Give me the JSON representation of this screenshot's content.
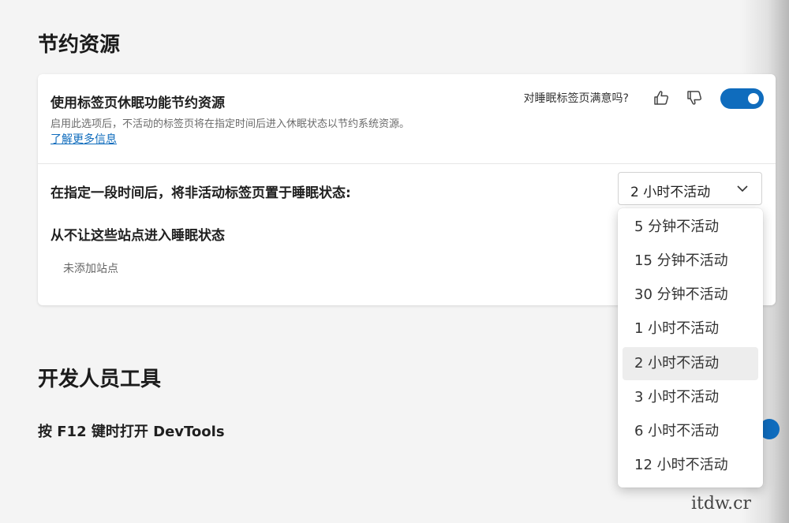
{
  "sections": {
    "save_resources": {
      "title": "节约资源",
      "sleeping_tabs": {
        "title": "使用标签页休眠功能节约资源",
        "description": "启用此选项后，不活动的标签页将在指定时间后进入休眠状态以节约系统资源。",
        "learn_more": "了解更多信息",
        "feedback_prompt": "对睡眠标签页满意吗?",
        "thumbs_up_icon": "thumbs-up-icon",
        "thumbs_down_icon": "thumbs-down-icon",
        "toggle_on": true
      },
      "sleep_after": {
        "label": "在指定一段时间后，将非活动标签页置于睡眠状态:",
        "selected": "2 小时不活动",
        "options": [
          "5 分钟不活动",
          "15 分钟不活动",
          "30 分钟不活动",
          "1 小时不活动",
          "2 小时不活动",
          "3 小时不活动",
          "6 小时不活动",
          "12 小时不活动"
        ]
      },
      "never_sleep": {
        "title": "从不让这些站点进入睡眠状态",
        "empty": "未添加站点"
      }
    },
    "developer_tools": {
      "title": "开发人员工具",
      "f12_label": "按 F12 键时打开 DevTools",
      "toggle_on": true
    }
  },
  "watermark": "itdw.cr",
  "colors": {
    "accent": "#0f6cbd",
    "background": "#f4f4f4",
    "card": "#ffffff"
  }
}
